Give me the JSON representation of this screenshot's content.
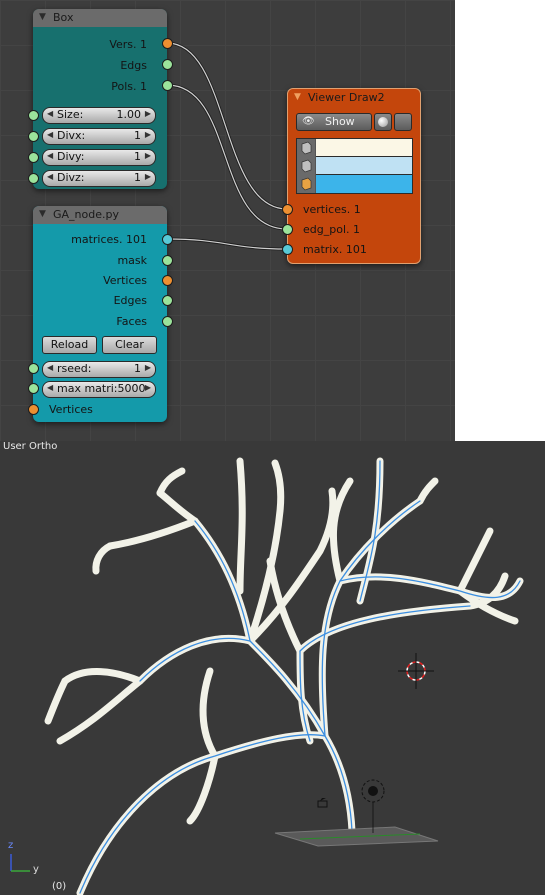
{
  "colors": {
    "box_node_body": "#17706e",
    "ga_node_body": "#149aaa",
    "viewer_node_body": "#c4460c",
    "socket_orange": "#ed8f31",
    "socket_green": "#9be39b",
    "socket_teal": "#58c9d6",
    "tree_stroke": "#f2f2e8",
    "tree_wire": "#3b8ee0"
  },
  "box_node": {
    "title": "Box",
    "outputs": [
      {
        "label": "Vers. 1"
      },
      {
        "label": "Edgs"
      },
      {
        "label": "Pols. 1"
      }
    ],
    "fields": [
      {
        "label": "Size:",
        "value": "1.00"
      },
      {
        "label": "Divx:",
        "value": "1"
      },
      {
        "label": "Divy:",
        "value": "1"
      },
      {
        "label": "Divz:",
        "value": "1"
      }
    ]
  },
  "ga_node": {
    "title": "GA_node.py",
    "outputs": [
      {
        "label": "matrices. 101"
      },
      {
        "label": "mask"
      },
      {
        "label": "Vertices"
      },
      {
        "label": "Edges"
      },
      {
        "label": "Faces"
      }
    ],
    "reload_label": "Reload",
    "clear_label": "Clear",
    "fields": [
      {
        "label": "rseed:",
        "value": "1"
      },
      {
        "label": "max matri:5000",
        "value": ""
      }
    ],
    "input_vertices": "Vertices"
  },
  "viewer_node": {
    "title": "Viewer Draw2",
    "show_label": "Show",
    "color_swatches": [
      "#fbf7e6",
      "#bfe1f3",
      "#3cb4ea"
    ],
    "inputs": [
      {
        "label": "vertices. 1"
      },
      {
        "label": "edg_pol. 1"
      },
      {
        "label": "matrix. 101"
      }
    ]
  },
  "viewport": {
    "view_label": "User Ortho",
    "frame_label": "(0)",
    "axis_z": "z",
    "axis_y": "y"
  }
}
